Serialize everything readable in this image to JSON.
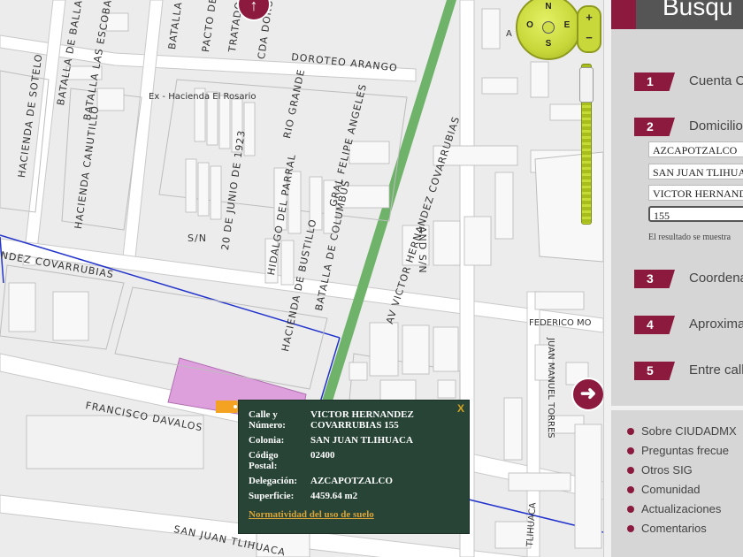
{
  "map": {
    "streets": [
      {
        "text": "BATALLA DE BALLAN",
        "id": "street-batalla-ballan"
      },
      {
        "text": "BATALLA LAS ESCOBAS",
        "id": "street-batalla-escobas"
      },
      {
        "text": "BATALLA",
        "id": "street-batalla"
      },
      {
        "text": "PACTO DE",
        "id": "street-pacto"
      },
      {
        "text": "TRATADO",
        "id": "street-tratado"
      },
      {
        "text": "CDA DOROTEO",
        "id": "street-cda-doroteo"
      },
      {
        "text": "DOROTEO ARANGO",
        "id": "street-doroteo-arango"
      },
      {
        "text": "HACIENDA DE SOTELO",
        "id": "street-hacienda-sotelo"
      },
      {
        "text": "HACIENDA CANUTILLO",
        "id": "street-hacienda-canutillo"
      },
      {
        "text": "Ex - Hacienda El Rosario",
        "id": "label-ex-hacienda"
      },
      {
        "text": "RIO GRANDE",
        "id": "street-rio-grande"
      },
      {
        "text": "GRAL FELIPE ANGELES",
        "id": "street-felipe-angeles"
      },
      {
        "text": "20 DE JUNIO DE 1923",
        "id": "street-20-junio"
      },
      {
        "text": "HIDALGO DEL PARRAL",
        "id": "street-hidalgo-parral"
      },
      {
        "text": "BATALLA DE COLUMBUS",
        "id": "street-batalla-columbus"
      },
      {
        "text": "S/N",
        "id": "street-sn-1"
      },
      {
        "text": "HACIENDA DE BUSTILLO",
        "id": "street-hacienda-bustillo"
      },
      {
        "text": "AV VICTOR HERNANDEZ COVARRUBIAS",
        "id": "street-av-victor"
      },
      {
        "text": "AND S/N",
        "id": "street-and-sn"
      },
      {
        "text": "NDEZ COVARRUBIAS",
        "id": "street-covarrubias"
      },
      {
        "text": "FRANCISCO DAVALOS",
        "id": "street-francisco-davalos"
      },
      {
        "text": "FEDERICO MO",
        "id": "street-federico"
      },
      {
        "text": "JUAN MANUEL TORRES",
        "id": "street-juan-manuel-torres"
      },
      {
        "text": "SAN JUAN TLIHUACA",
        "id": "street-san-juan-tlihuaca"
      },
      {
        "text": "TLIHUACA",
        "id": "street-tlihuaca"
      },
      {
        "text": "A",
        "id": "street-a"
      }
    ],
    "compass": {
      "n": "N",
      "s": "S",
      "e": "E",
      "o": "O"
    },
    "zoom": {
      "plus": "+",
      "minus": "−"
    },
    "nav_arrow": "➜",
    "nav_up": "↑",
    "highlight_color": "#dda0dd"
  },
  "popup": {
    "close": "X",
    "rows": [
      {
        "key": "Calle y Número:",
        "value": "VICTOR HERNANDEZ COVARRUBIAS 155"
      },
      {
        "key": "Colonia:",
        "value": "SAN JUAN TLIHUACA"
      },
      {
        "key": "Código Postal:",
        "value": "02400"
      },
      {
        "key": "Delegación:",
        "value": "AZCAPOTZALCO"
      },
      {
        "key": "Superficie:",
        "value": "4459.64 m2"
      }
    ],
    "link": "Normatividad del uso de suelo"
  },
  "panel": {
    "title": "Busqu",
    "steps": [
      {
        "num": "1",
        "label": "Cuenta Ca"
      },
      {
        "num": "2",
        "label": "Domicilio"
      },
      {
        "num": "3",
        "label": "Coordena"
      },
      {
        "num": "4",
        "label": "Aproxima"
      },
      {
        "num": "5",
        "label": "Entre calle"
      }
    ],
    "fields": [
      {
        "value": "AZCAPOTZALCO"
      },
      {
        "value": "SAN JUAN TLIHUA"
      },
      {
        "value": "VICTOR HERNAND"
      },
      {
        "value": "155"
      }
    ],
    "result_note": "El resultado se muestra",
    "links": [
      "Sobre CIUDADMX",
      "Preguntas frecue",
      "Otros SIG",
      "Comunidad",
      "Actualizaciones",
      "Comentarios"
    ],
    "accent_color": "#8b1a3e"
  }
}
